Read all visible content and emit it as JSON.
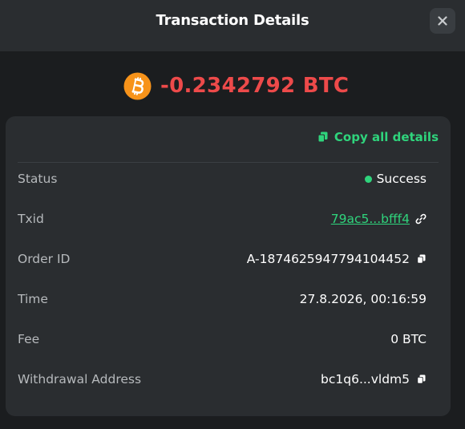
{
  "header": {
    "title": "Transaction Details"
  },
  "amount": {
    "text": "-0.2342792 BTC",
    "color": "#ed4a4a",
    "icon": "bitcoin-icon"
  },
  "card": {
    "copy_all_label": "Copy all details"
  },
  "details": {
    "status": {
      "label": "Status",
      "value": "Success"
    },
    "txid": {
      "label": "Txid",
      "value": "79ac5...bfff4"
    },
    "order_id": {
      "label": "Order ID",
      "value": "A-187462594779410445​2"
    },
    "time": {
      "label": "Time",
      "value": "27.8.2026, 00:16:59"
    },
    "fee": {
      "label": "Fee",
      "value": "0 BTC"
    },
    "withdrawal_address": {
      "label": "Withdrawal Address",
      "value": "bc1q6...vldm5"
    }
  },
  "colors": {
    "accent": "#2fd47c",
    "negative": "#ed4a4a",
    "bitcoin": "#f7931a"
  }
}
